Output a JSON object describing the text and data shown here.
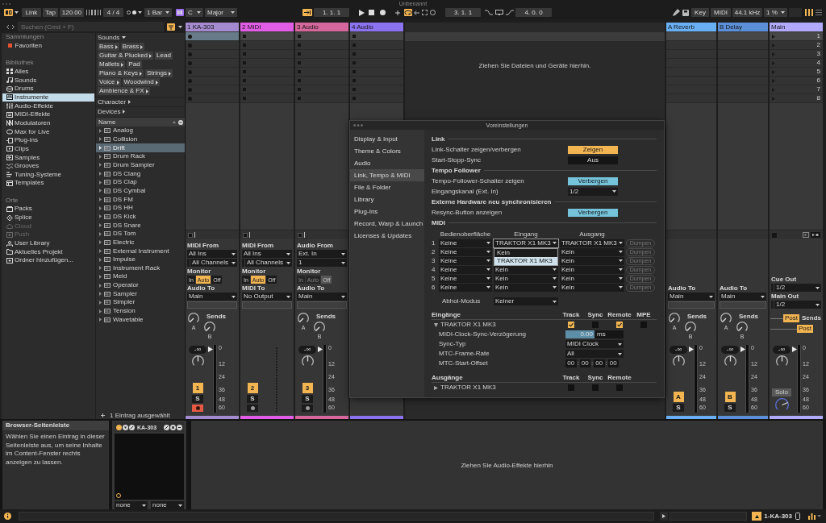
{
  "window": {
    "title": "Unbenannt"
  },
  "toolbar": {
    "browser_toggle": {
      "on": true
    },
    "link": "Link",
    "tap": "Tap",
    "tempo": "120.00",
    "time_signature": "4 / 4",
    "quantization": "1 Bar",
    "scale": {
      "on": true,
      "root": "C",
      "mode": "Major"
    },
    "follow": {
      "on": true
    },
    "position": "1. 1. 1",
    "loop": {
      "on": true,
      "start": "3. 1. 1",
      "length": "4. 0. 0"
    },
    "key_map": "Key",
    "midi_map": "MIDI",
    "sample_rate": "44.1 kHz",
    "cpu_load": "1 %",
    "mixer_toggle": {
      "on": true
    }
  },
  "browser": {
    "search": {
      "placeholder": "Suchen (Cmd + F)"
    },
    "filter_on": true,
    "sidebar": [
      {
        "heading": "Sammlungen",
        "items": [
          {
            "label": "Favoriten",
            "color": "#e5532f",
            "selected": false,
            "disabled": false
          }
        ]
      },
      {
        "heading": "Bibliothek",
        "items": [
          {
            "label": "Alles",
            "selected": false,
            "disabled": false
          },
          {
            "label": "Sounds",
            "selected": false,
            "disabled": false
          },
          {
            "label": "Drums",
            "selected": false,
            "disabled": false
          },
          {
            "label": "Instrumente",
            "selected": true,
            "disabled": false
          },
          {
            "label": "Audio-Effekte",
            "selected": false,
            "disabled": false
          },
          {
            "label": "MIDI-Effekte",
            "selected": false,
            "disabled": false
          },
          {
            "label": "Modulatoren",
            "selected": false,
            "disabled": false
          },
          {
            "label": "Max for Live",
            "selected": false,
            "disabled": false
          },
          {
            "label": "Plug-ins",
            "selected": false,
            "disabled": false
          },
          {
            "label": "Clips",
            "selected": false,
            "disabled": false
          },
          {
            "label": "Samples",
            "selected": false,
            "disabled": false
          },
          {
            "label": "Grooves",
            "selected": false,
            "disabled": false
          },
          {
            "label": "Tuning-Systeme",
            "selected": false,
            "disabled": false
          },
          {
            "label": "Templates",
            "selected": false,
            "disabled": false
          }
        ]
      },
      {
        "heading": "Orte",
        "items": [
          {
            "label": "Packs",
            "selected": false,
            "disabled": false
          },
          {
            "label": "Splice",
            "selected": false,
            "disabled": false
          },
          {
            "label": "Cloud",
            "selected": false,
            "disabled": true
          },
          {
            "label": "Push",
            "selected": false,
            "disabled": true
          },
          {
            "label": "User Library",
            "selected": false,
            "disabled": false
          },
          {
            "label": "Aktuelles Projekt",
            "selected": false,
            "disabled": false
          },
          {
            "label": "Ordner hinzufügen...",
            "selected": false,
            "disabled": false
          }
        ]
      }
    ],
    "sounds": {
      "label": "Sounds",
      "tags": [
        {
          "label": "Bass",
          "has_children": true
        },
        {
          "label": "Brass",
          "has_children": true
        },
        {
          "label": "Guitar & Plucked",
          "has_children": true
        },
        {
          "label": "Lead",
          "has_children": false
        },
        {
          "label": "Mallets",
          "has_children": true
        },
        {
          "label": "Pad",
          "has_children": false
        },
        {
          "label": "Piano & Keys",
          "has_children": true
        },
        {
          "label": "Strings",
          "has_children": true
        },
        {
          "label": "Voice",
          "has_children": true
        },
        {
          "label": "Woodwind",
          "has_children": true
        },
        {
          "label": "Ambience & FX",
          "has_children": true
        }
      ]
    },
    "filters": [
      {
        "label": "Character"
      },
      {
        "label": "Devices"
      }
    ],
    "list": {
      "column": "Name",
      "items": [
        {
          "label": "Analog",
          "selected": false
        },
        {
          "label": "Collision",
          "selected": false
        },
        {
          "label": "Drift",
          "selected": true
        },
        {
          "label": "Drum Rack",
          "selected": false
        },
        {
          "label": "Drum Sampler",
          "selected": false
        },
        {
          "label": "DS Clang",
          "selected": false
        },
        {
          "label": "DS Clap",
          "selected": false
        },
        {
          "label": "DS Cymbal",
          "selected": false
        },
        {
          "label": "DS FM",
          "selected": false
        },
        {
          "label": "DS HH",
          "selected": false
        },
        {
          "label": "DS Kick",
          "selected": false
        },
        {
          "label": "DS Snare",
          "selected": false
        },
        {
          "label": "DS Tom",
          "selected": false
        },
        {
          "label": "Electric",
          "selected": false
        },
        {
          "label": "External Instrument",
          "selected": false
        },
        {
          "label": "Impulse",
          "selected": false
        },
        {
          "label": "Instrument Rack",
          "selected": false
        },
        {
          "label": "Meld",
          "selected": false
        },
        {
          "label": "Operator",
          "selected": false
        },
        {
          "label": "Sampler",
          "selected": false
        },
        {
          "label": "Simpler",
          "selected": false
        },
        {
          "label": "Tension",
          "selected": false
        },
        {
          "label": "Wavetable",
          "selected": false
        }
      ]
    },
    "footer": "1 Eintrag ausgewählt"
  },
  "session": {
    "drop_hint": "Ziehen Sie Dateien und Geräte hierhin.",
    "tracks": [
      {
        "kind": "instrument",
        "name": "1 KA-303",
        "color": "#a48bd0",
        "armed": true,
        "slots": [
          {
            "selected": true
          },
          {
            "selected": false
          },
          {
            "selected": false
          },
          {
            "selected": false
          },
          {
            "selected": false
          },
          {
            "selected": false
          },
          {
            "selected": false
          },
          {
            "selected": false
          }
        ],
        "io": [
          {
            "kind": "label",
            "text": "MIDI From"
          },
          {
            "kind": "dropdown",
            "text": "All Ins"
          },
          {
            "kind": "dropdown",
            "text": "All Channels",
            "sub": true
          },
          {
            "kind": "label",
            "text": "Monitor"
          },
          {
            "kind": "monitor",
            "disabled": false,
            "options": [
              {
                "label": "In",
                "selected": false
              },
              {
                "label": "Auto",
                "selected": true
              },
              {
                "label": "Off",
                "selected": false
              }
            ]
          },
          {
            "kind": "label",
            "text": "Audio To"
          },
          {
            "kind": "dropdown",
            "text": "Main"
          },
          {
            "kind": "field"
          }
        ],
        "sends": {
          "kind": "knobs",
          "label": "Sends",
          "knobs": [
            "A",
            "B"
          ]
        },
        "mixer": {
          "volume": "-∞",
          "number": {
            "label": "1",
            "on": true
          },
          "solo": "S",
          "level": 0.97,
          "scale": [
            "0",
            "12",
            "24",
            "36",
            "48",
            "60"
          ]
        }
      },
      {
        "kind": "midi",
        "name": "2 MIDI",
        "color": "#e25de6",
        "armed": false,
        "slots": [
          {
            "selected": false
          },
          {
            "selected": false
          },
          {
            "selected": false
          },
          {
            "selected": false
          },
          {
            "selected": false
          },
          {
            "selected": false
          },
          {
            "selected": false
          },
          {
            "selected": false
          }
        ],
        "io": [
          {
            "kind": "label",
            "text": "MIDI From"
          },
          {
            "kind": "dropdown",
            "text": "All Ins"
          },
          {
            "kind": "dropdown",
            "text": "All Channels",
            "sub": true
          },
          {
            "kind": "label",
            "text": "Monitor"
          },
          {
            "kind": "monitor",
            "disabled": false,
            "options": [
              {
                "label": "In",
                "selected": false
              },
              {
                "label": "Auto",
                "selected": true
              },
              {
                "label": "Off",
                "selected": false
              }
            ]
          },
          {
            "kind": "label",
            "text": "MIDI To"
          },
          {
            "kind": "dropdown",
            "text": "No Output"
          },
          {
            "kind": "field"
          }
        ],
        "mixer": {
          "number": {
            "label": "2",
            "on": true
          },
          "solo": "S"
        }
      },
      {
        "kind": "audio",
        "name": "3 Audio",
        "color": "#d5679c",
        "armed": false,
        "slots": [
          {
            "selected": false
          },
          {
            "selected": false
          },
          {
            "selected": false
          },
          {
            "selected": false
          },
          {
            "selected": false
          },
          {
            "selected": false
          },
          {
            "selected": false
          },
          {
            "selected": false
          }
        ],
        "io": [
          {
            "kind": "label",
            "text": "Audio From"
          },
          {
            "kind": "dropdown",
            "text": "Ext. In"
          },
          {
            "kind": "dropdown",
            "text": "1"
          },
          {
            "kind": "label",
            "text": "Monitor"
          },
          {
            "kind": "monitor",
            "disabled": true,
            "options": [
              {
                "label": "In",
                "selected": false
              },
              {
                "label": "Auto",
                "selected": false
              },
              {
                "label": "Off",
                "selected": true
              }
            ]
          },
          {
            "kind": "label",
            "text": "Audio To"
          },
          {
            "kind": "dropdown",
            "text": "Main"
          },
          {
            "kind": "field"
          }
        ],
        "sends": {
          "kind": "knobs",
          "label": "Sends",
          "knobs": [
            "A",
            "B"
          ]
        },
        "mixer": {
          "volume": "-∞",
          "number": {
            "label": "3",
            "on": true
          },
          "solo": "S",
          "level": 0.97,
          "scale": [
            "0",
            "12",
            "24",
            "36",
            "48",
            "60"
          ]
        }
      },
      {
        "kind": "audio",
        "name": "4 Audio",
        "color": "#8b72ef",
        "armed": false,
        "slots": [
          {
            "selected": false
          },
          {
            "selected": false
          },
          {
            "selected": false
          },
          {
            "selected": false
          },
          {
            "selected": false
          },
          {
            "selected": false
          },
          {
            "selected": false
          },
          {
            "selected": false
          }
        ]
      },
      {
        "kind": "return",
        "name": "A Reverb",
        "color": "#68aff3",
        "io": [
          {
            "kind": "label",
            "text": "Audio To"
          },
          {
            "kind": "dropdown",
            "text": "Main"
          },
          {
            "kind": "field"
          }
        ],
        "sends": {
          "kind": "knobs",
          "label": "Sends",
          "knobs": [
            "A",
            "B"
          ]
        },
        "mixer": {
          "volume": "-∞",
          "number": {
            "label": "A",
            "on": true
          },
          "solo": "S",
          "level": 0.97,
          "scale": [
            "0",
            "12",
            "24",
            "36",
            "48",
            "60"
          ]
        }
      },
      {
        "kind": "return",
        "name": "B Delay",
        "color": "#5b90d8",
        "io": [
          {
            "kind": "label",
            "text": "Audio To"
          },
          {
            "kind": "dropdown",
            "text": "Main"
          },
          {
            "kind": "field"
          }
        ],
        "sends": {
          "kind": "knobs",
          "label": "Sends",
          "knobs": [
            "A",
            "B"
          ]
        },
        "mixer": {
          "volume": "-∞",
          "number": {
            "label": "B",
            "on": true
          },
          "solo": "S",
          "level": 0.97,
          "scale": [
            "0",
            "12",
            "24",
            "36",
            "48",
            "60"
          ]
        }
      },
      {
        "kind": "main",
        "name": "Main",
        "color": "#b1aafc",
        "scenes": [
          {
            "number": "1",
            "selected": true
          },
          {
            "number": "2",
            "selected": false
          },
          {
            "number": "3",
            "selected": false
          },
          {
            "number": "4",
            "selected": false
          },
          {
            "number": "5",
            "selected": false
          },
          {
            "number": "6",
            "selected": false
          },
          {
            "number": "7",
            "selected": false
          },
          {
            "number": "8",
            "selected": false
          }
        ],
        "io": [
          {
            "kind": "label",
            "text": "Cue Out"
          },
          {
            "kind": "dropdown",
            "text": "1/2",
            "sub": true
          },
          {
            "kind": "label",
            "text": "Main Out"
          },
          {
            "kind": "dropdown",
            "text": "1/2",
            "sub": true
          }
        ],
        "sends": {
          "kind": "post",
          "label": "Sends",
          "buttons": [
            {
              "label": "Post",
              "on": true
            },
            {
              "label": "Post",
              "on": true
            }
          ]
        },
        "mixer": {
          "volume": "-∞",
          "solo": "Solo",
          "level": 0.97,
          "scale": [
            "0",
            "12",
            "24",
            "36",
            "48",
            "60"
          ]
        }
      }
    ]
  },
  "preferences": {
    "title": "Voreinstellungen",
    "nav": [
      {
        "label": "Display & Input",
        "selected": false
      },
      {
        "label": "Theme & Colors",
        "selected": false
      },
      {
        "label": "Audio",
        "selected": false
      },
      {
        "label": "Link, Tempo & MIDI",
        "selected": true
      },
      {
        "label": "File & Folder",
        "selected": false
      },
      {
        "label": "Library",
        "selected": false
      },
      {
        "label": "Plug-Ins",
        "selected": false
      },
      {
        "label": "Record, Warp & Launch",
        "selected": false
      },
      {
        "label": "Licenses & Updates",
        "selected": false
      }
    ],
    "sections": [
      {
        "heading": "Link",
        "rows": [
          {
            "label": "Link-Schalter zeigen/verbergen",
            "control": {
              "kind": "toggle",
              "text": "Zeigen",
              "on": true
            }
          },
          {
            "label": "Start-Stopp-Sync",
            "control": {
              "kind": "toggle",
              "text": "Aus",
              "on": false
            }
          }
        ]
      },
      {
        "heading": "Tempo Follower",
        "rows": [
          {
            "label": "Tempo-Follower-Schalter zeigen",
            "control": {
              "kind": "choice",
              "text": "Verbergen"
            }
          },
          {
            "label": "Eingangskanal (Ext. In)",
            "control": {
              "kind": "dropdown",
              "text": "1/2"
            }
          }
        ]
      },
      {
        "heading": "Externe Hardware neu synchronisieren",
        "rows": [
          {
            "label": "Resync-Button anzeigen",
            "control": {
              "kind": "choice",
              "text": "Verbergen"
            }
          }
        ]
      }
    ],
    "midi": {
      "heading": "MIDI",
      "columns": [
        "Bedienoberfläche",
        "Eingang",
        "Ausgang"
      ],
      "rows": [
        {
          "number": "1",
          "surface": "Keine",
          "input": "TRAKTOR X1 MK3",
          "input_menu": [
            {
              "label": "Kein",
              "selected": false
            },
            {
              "label": "TRAKTOR X1 MK3",
              "selected": true
            }
          ],
          "output": "TRAKTOR X1 MK3",
          "dump": {
            "label": "Dumpen",
            "disabled": true
          }
        },
        {
          "number": "2",
          "surface": "Keine",
          "output": "Kein",
          "dump": {
            "label": "Dumpen",
            "disabled": true
          }
        },
        {
          "number": "3",
          "surface": "Keine",
          "output": "Kein",
          "dump": {
            "label": "Dumpen",
            "disabled": true
          }
        },
        {
          "number": "4",
          "surface": "Keine",
          "input": "Kein",
          "output": "Kein",
          "dump": {
            "label": "Dumpen",
            "disabled": true
          }
        },
        {
          "number": "5",
          "surface": "Keine",
          "input": "Kein",
          "output": "Kein",
          "dump": {
            "label": "Dumpen",
            "disabled": true
          }
        },
        {
          "number": "6",
          "surface": "Keine",
          "input": "Kein",
          "output": "Kein",
          "dump": {
            "label": "Dumpen",
            "disabled": true
          }
        }
      ],
      "takeover": {
        "label": "Abhol-Modus",
        "value": "Keiner"
      }
    },
    "ports": [
      {
        "heading": "Eingänge",
        "columns": [
          "Track",
          "Sync",
          "Remote",
          "MPE"
        ],
        "devices": [
          {
            "name": "TRAKTOR X1 MK3",
            "expanded": true,
            "options": [
              {
                "checked": true
              },
              {
                "checked": false
              },
              {
                "checked": true
              },
              {
                "checked": false
              }
            ],
            "settings": [
              {
                "label": "MIDI-Clock-Sync-Verzögerung",
                "control": {
                  "kind": "slider",
                  "text": "0.00",
                  "unit": "ms",
                  "level": 0.5
                }
              },
              {
                "label": "Sync-Typ",
                "control": {
                  "kind": "dropdown",
                  "text": "MIDI Clock"
                }
              },
              {
                "label": "MTC-Frame-Rate",
                "control": {
                  "kind": "dropdown",
                  "text": "All"
                }
              },
              {
                "label": "MTC-Start-Offset",
                "control": {
                  "kind": "timecode",
                  "parts": [
                    "00",
                    "00",
                    "00",
                    "00"
                  ],
                  "separator": ":"
                }
              }
            ]
          }
        ]
      },
      {
        "heading": "Ausgänge",
        "columns": [
          "Track",
          "Sync",
          "Remote"
        ],
        "devices": [
          {
            "name": "TRAKTOR X1 MK3",
            "expanded": false,
            "options": [
              {
                "checked": false
              },
              {
                "checked": false
              },
              {
                "checked": false
              }
            ]
          }
        ]
      }
    ]
  },
  "info_panel": {
    "title": "Browser-Seitenleiste",
    "text": "Wählen Sie einen Eintrag in dieser Seitenleiste aus, um seine Inhalte im Content-Fenster rechts anzeigen zu lassen."
  },
  "device": {
    "name": "KA-303",
    "on": true,
    "selectors": [
      "none",
      "none"
    ]
  },
  "device_drop_hint": "Ziehen Sie Audio-Effekte hierhin",
  "status_bar": {
    "track": "1-KA-303"
  }
}
